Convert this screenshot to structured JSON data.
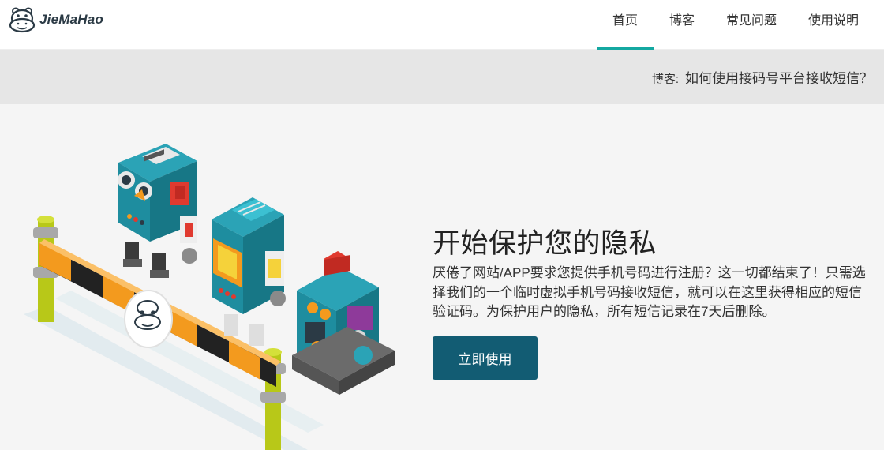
{
  "header": {
    "brand": "JieMaHao",
    "logo_icon": "hippo-logo-icon",
    "nav": [
      {
        "label": "首页",
        "active": true
      },
      {
        "label": "博客",
        "active": false
      },
      {
        "label": "常见问题",
        "active": false
      },
      {
        "label": "使用说明",
        "active": false
      }
    ],
    "accent_color": "#14a8a1"
  },
  "notice": {
    "label": "博客:",
    "link_text": "如何使用接码号平台接收短信？"
  },
  "hero": {
    "illustration": "robots-at-barrier-illustration",
    "title": "开始保护您的隐私",
    "description": "厌倦了网站/APP要求您提供手机号码进行注册？这一切都结束了！只需选择我们的一个临时虚拟手机号码接收短信，就可以在这里获得相应的短信验证码。为保护用户的隐私，所有短信记录在7天后删除。",
    "cta_label": "立即使用",
    "cta_color": "#125c73"
  }
}
